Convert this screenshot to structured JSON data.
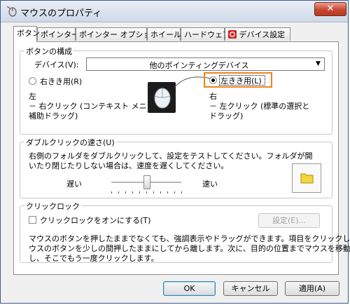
{
  "window": {
    "title": "マウスのプロパティ"
  },
  "tabs": [
    {
      "label": "ボタン"
    },
    {
      "label": "ポインター"
    },
    {
      "label": "ポインター オプション"
    },
    {
      "label": "ホイール"
    },
    {
      "label": "ハードウェア"
    },
    {
      "label": "デバイス設定"
    }
  ],
  "button_config": {
    "group_label": "ボタンの構成",
    "device_label": "デバイス(V):",
    "device_value": "他のポインティングデバイス",
    "right_hand_label": "右きき用(R)",
    "left_hand_label": "左きき用(L)",
    "left_title": "左",
    "left_desc_line1": "－ 右クリック (コンテキスト メニューと",
    "left_desc_line2": "補助ドラッグ)",
    "right_title": "右",
    "right_desc_line1": "－ 左クリック (標準の選択と",
    "right_desc_line2": "ドラッグ)"
  },
  "double_click": {
    "group_label": "ダブルクリックの速さ(U)",
    "desc_line1": "右側のフォルダをダブルクリックして、設定をテストしてください。フォルダが開",
    "desc_line2": "いたり閉じたりしない場合は、速度を遅くしてください。",
    "slow_label": "遅い",
    "fast_label": "速い",
    "speed_fraction": 0.5
  },
  "click_lock": {
    "group_label": "クリックロック",
    "checkbox_label": "クリックロックをオンにする(T)",
    "settings_button": "設定(E)...",
    "desc_line1": "マウスのボタンを押したままでなくても、強調表示やドラッグができます。項目をクリックし、マ",
    "desc_line2": "ウスのボタンを少しの間押したままにしてから離します。次に、目的の位置までマウスを移動",
    "desc_line3": "し、そこでもう一度クリックします。"
  },
  "footer": {
    "ok": "OK",
    "cancel": "キャンセル",
    "apply": "適用(A)"
  },
  "colors": {
    "highlight": "#f0821e",
    "tab_icon": "#d2231e",
    "folder": "#f5d63a"
  }
}
